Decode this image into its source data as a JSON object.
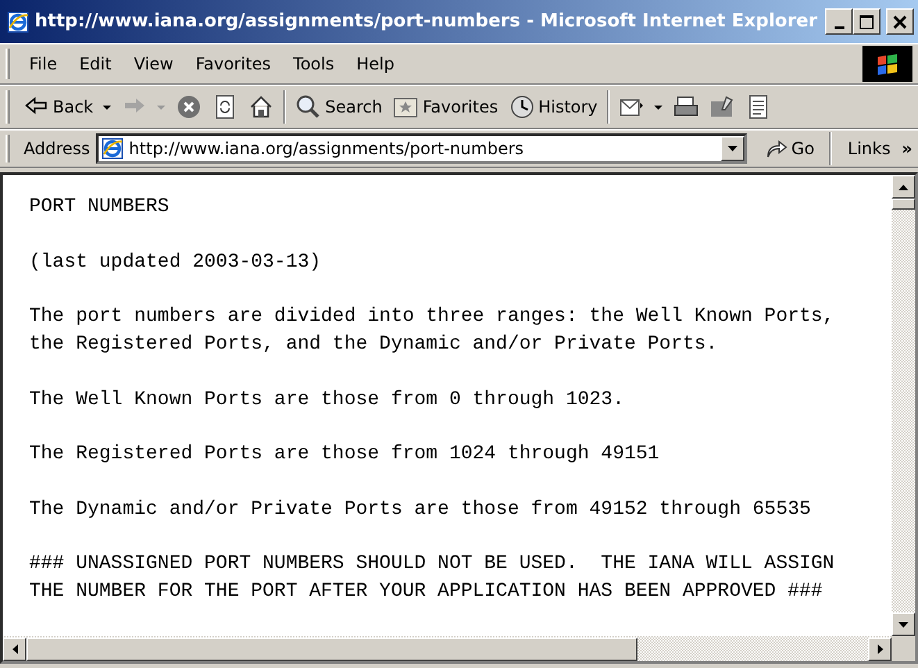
{
  "window": {
    "title": "http://www.iana.org/assignments/port-numbers - Microsoft Internet Explorer"
  },
  "menu": [
    "File",
    "Edit",
    "View",
    "Favorites",
    "Tools",
    "Help"
  ],
  "toolbar": [
    {
      "kind": "back",
      "label": "Back",
      "disabled": false
    },
    {
      "kind": "forward",
      "disabled": true
    },
    {
      "kind": "stop",
      "disabled": false
    },
    {
      "kind": "refresh",
      "disabled": false
    },
    {
      "kind": "home",
      "disabled": false
    },
    {
      "kind": "search",
      "label": "Search",
      "disabled": false
    },
    {
      "kind": "favorites",
      "label": "Favorites",
      "disabled": false
    },
    {
      "kind": "history",
      "label": "History",
      "disabled": false
    },
    {
      "kind": "mail",
      "disabled": false
    },
    {
      "kind": "print",
      "disabled": false
    },
    {
      "kind": "edit",
      "disabled": false
    },
    {
      "kind": "discuss",
      "disabled": false
    }
  ],
  "address_bar": {
    "label": "Address",
    "url": "http://www.iana.org/assignments/port-numbers",
    "go": "Go",
    "links": "Links",
    "more": "»"
  },
  "document": [
    {
      "kind": "text",
      "lines": [
        "PORT NUMBERS"
      ]
    },
    {
      "kind": "text",
      "lines": [
        "(last updated 2003-03-13)"
      ]
    },
    {
      "kind": "text",
      "lines": [
        "The port numbers are divided into three ranges: the Well Known Ports,",
        "the Registered Ports, and the Dynamic and/or Private Ports."
      ]
    },
    {
      "kind": "text",
      "lines": [
        "The Well Known Ports are those from 0 through 1023."
      ]
    },
    {
      "kind": "text",
      "lines": [
        "The Registered Ports are those from 1024 through 49151"
      ]
    },
    {
      "kind": "text",
      "lines": [
        "The Dynamic and/or Private Ports are those from 49152 through 65535"
      ]
    },
    {
      "kind": "notice",
      "lines": [
        "### UNASSIGNED PORT NUMBERS SHOULD NOT BE USED.  THE IANA WILL ASSIGN",
        "THE NUMBER FOR THE PORT AFTER YOUR APPLICATION HAS BEEN APPROVED ###"
      ]
    }
  ]
}
